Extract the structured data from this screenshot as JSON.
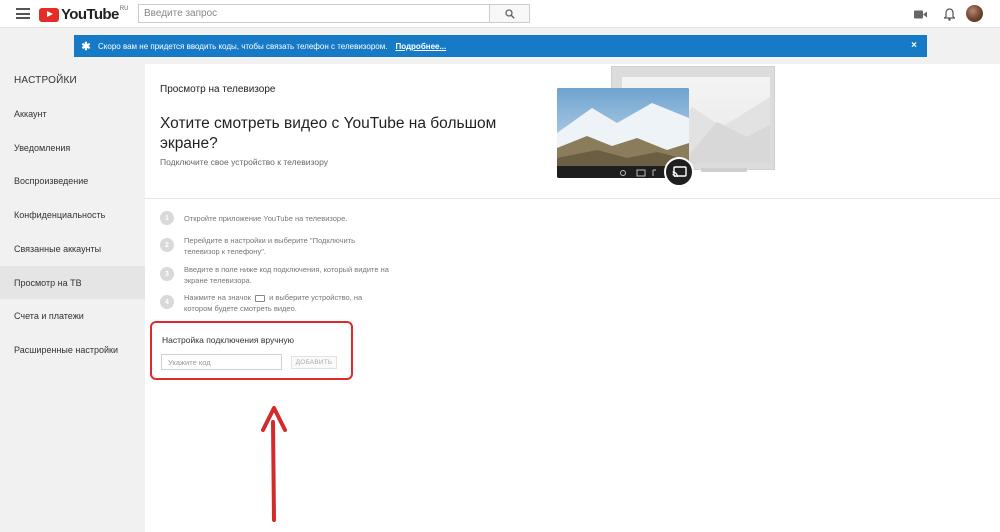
{
  "header": {
    "logo_text": "YouTube",
    "logo_region": "RU",
    "search_placeholder": "Введите запрос"
  },
  "banner": {
    "text": "Скоро вам не придется вводить коды, чтобы связать телефон с телевизором.",
    "link": "Подробнее...",
    "close": "×",
    "star": "✱"
  },
  "sidebar": {
    "title": "НАСТРОЙКИ",
    "items": [
      {
        "label": "Аккаунт"
      },
      {
        "label": "Уведомления"
      },
      {
        "label": "Воспроизведение"
      },
      {
        "label": "Конфиденциальность"
      },
      {
        "label": "Связанные аккаунты"
      },
      {
        "label": "Просмотр на ТВ"
      },
      {
        "label": "Счета и платежи"
      },
      {
        "label": "Расширенные настройки"
      }
    ],
    "active_index": 5
  },
  "main": {
    "section_title": "Просмотр на телевизоре",
    "headline": "Хотите смотреть видео с YouTube на большом экране?",
    "subline": "Подключите свое устройство к телевизору",
    "steps": [
      {
        "num": "1",
        "text": "Откройте приложение YouTube на телевизоре."
      },
      {
        "num": "2",
        "text": "Перейдите в настройки и выберите \"Подключить телевизор к телефону\"."
      },
      {
        "num": "3",
        "text": "Введите в поле ниже код подключения, который видите на экране телевизора."
      },
      {
        "num": "4",
        "text_before": "Нажмите на значок",
        "text_after": "и выберите устройство, на котором будете смотреть видео."
      }
    ],
    "manual": {
      "title": "Настройка подключения вручную",
      "input_placeholder": "Укажите код",
      "button_label": "ДОБАВИТЬ"
    }
  },
  "colors": {
    "banner_bg": "#167ac6",
    "logo_red": "#e52d27",
    "highlight_red": "#e02a2a"
  },
  "icons": [
    "menu-icon",
    "search-icon",
    "video-camera-icon",
    "bell-icon",
    "cast-icon",
    "settings-icon"
  ]
}
